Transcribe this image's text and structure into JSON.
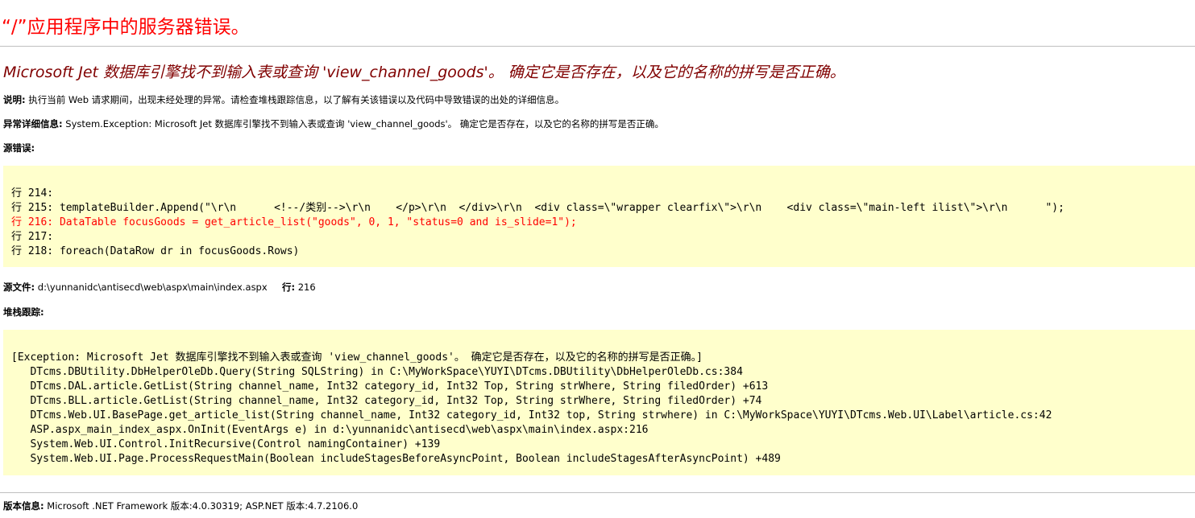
{
  "page": {
    "title": "“/”应用程序中的服务器错误。"
  },
  "error": {
    "heading": "Microsoft Jet 数据库引擎找不到输入表或查询 'view_channel_goods'。 确定它是否存在，以及它的名称的拼写是否正确。"
  },
  "description": {
    "label": "说明:",
    "text": "执行当前 Web 请求期间，出现未经处理的异常。请检查堆栈跟踪信息，以了解有关该错误以及代码中导致错误的出处的详细信息。"
  },
  "exception_details": {
    "label": "异常详细信息:",
    "text": "System.Exception: Microsoft Jet 数据库引擎找不到输入表或查询 'view_channel_goods'。 确定它是否存在，以及它的名称的拼写是否正确。"
  },
  "source_error": {
    "label": "源错误:",
    "lines": [
      "行 214:",
      "行 215: templateBuilder.Append(\"\\r\\n      <!--/类别-->\\r\\n    </p>\\r\\n  </div>\\r\\n  <div class=\\\"wrapper clearfix\\\">\\r\\n    <div class=\\\"main-left ilist\\\">\\r\\n      \");",
      "行 216: DataTable focusGoods = get_article_list(\"goods\", 0, 1, \"status=0 and is_slide=1\");",
      "行 217:",
      "行 218: foreach(DataRow dr in focusGoods.Rows)"
    ],
    "highlight_line": "216"
  },
  "source_file": {
    "label": "源文件:",
    "path": "d:\\yunnanidc\\antisecd\\web\\aspx\\main\\index.aspx",
    "line_label": "行:",
    "line_number": "216"
  },
  "stack_trace": {
    "label": "堆栈跟踪:",
    "lines": [
      "[Exception: Microsoft Jet 数据库引擎找不到输入表或查询 'view_channel_goods'。 确定它是否存在，以及它的名称的拼写是否正确。]",
      "   DTcms.DBUtility.DbHelperOleDb.Query(String SQLString) in C:\\MyWorkSpace\\YUYI\\DTcms.DBUtility\\DbHelperOleDb.cs:384",
      "   DTcms.DAL.article.GetList(String channel_name, Int32 category_id, Int32 Top, String strWhere, String filedOrder) +613",
      "   DTcms.BLL.article.GetList(String channel_name, Int32 category_id, Int32 Top, String strWhere, String filedOrder) +74",
      "   DTcms.Web.UI.BasePage.get_article_list(String channel_name, Int32 category_id, Int32 top, String strwhere) in C:\\MyWorkSpace\\YUYI\\DTcms.Web.UI\\Label\\article.cs:42",
      "   ASP.aspx_main_index_aspx.OnInit(EventArgs e) in d:\\yunnanidc\\antisecd\\web\\aspx\\main\\index.aspx:216",
      "   System.Web.UI.Control.InitRecursive(Control namingContainer) +139",
      "   System.Web.UI.Page.ProcessRequestMain(Boolean includeStagesBeforeAsyncPoint, Boolean includeStagesAfterAsyncPoint) +489"
    ]
  },
  "version": {
    "label": "版本信息:",
    "text": "Microsoft .NET Framework 版本:4.0.30319; ASP.NET 版本:4.7.2106.0"
  },
  "colors": {
    "title": "#ff0000",
    "heading": "#800000",
    "code_background": "#ffffcc",
    "highlight": "#ff0000"
  }
}
